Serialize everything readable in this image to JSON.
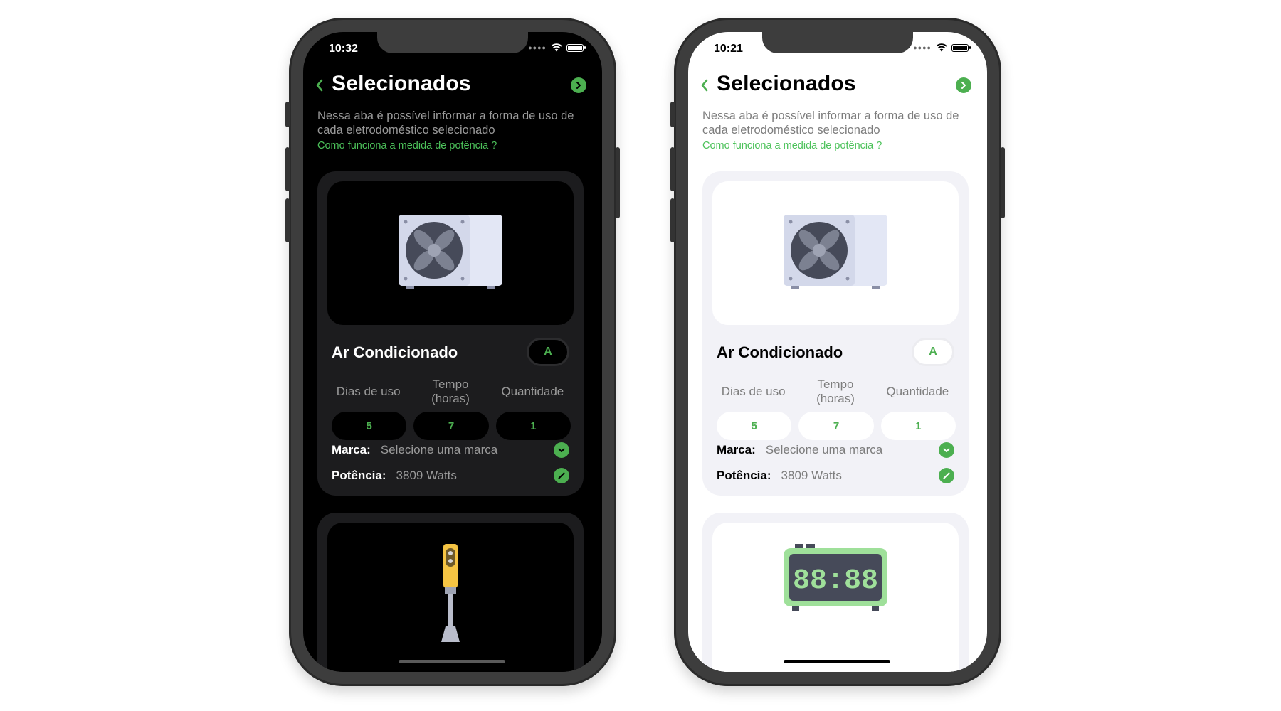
{
  "phones": [
    {
      "theme": "dark",
      "status": {
        "time": "10:32"
      },
      "header": {
        "title": "Selecionados"
      },
      "description": "Nessa aba é possível informar a forma de uso de cada eletrodoméstico selecionado",
      "help_link": "Como funciona a medida de potência ?",
      "card": {
        "name": "Ar Condicionado",
        "grade": "A",
        "columns": [
          "Dias de uso",
          "Tempo\n(horas)",
          "Quantidade"
        ],
        "values": [
          "5",
          "7",
          "1"
        ],
        "brand_label": "Marca:",
        "brand_value": "Selecione uma marca",
        "power_label": "Potência:",
        "power_value": "3809 Watts",
        "image_icon": "air-conditioner-icon"
      },
      "next_card_icon": "hand-blender-icon"
    },
    {
      "theme": "light",
      "status": {
        "time": "10:21"
      },
      "header": {
        "title": "Selecionados"
      },
      "description": "Nessa aba é possível informar a forma de uso de cada eletrodoméstico selecionado",
      "help_link": "Como funciona a medida de potência ?",
      "card": {
        "name": "Ar Condicionado",
        "grade": "A",
        "columns": [
          "Dias de uso",
          "Tempo\n(horas)",
          "Quantidade"
        ],
        "values": [
          "5",
          "7",
          "1"
        ],
        "brand_label": "Marca:",
        "brand_value": "Selecione uma marca",
        "power_label": "Potência:",
        "power_value": "3809 Watts",
        "image_icon": "air-conditioner-icon"
      },
      "next_card_icon": "digital-clock-icon",
      "clock_display": "88:88"
    }
  ],
  "colors": {
    "accent": "#4caf50",
    "link": "#4cc25a"
  }
}
